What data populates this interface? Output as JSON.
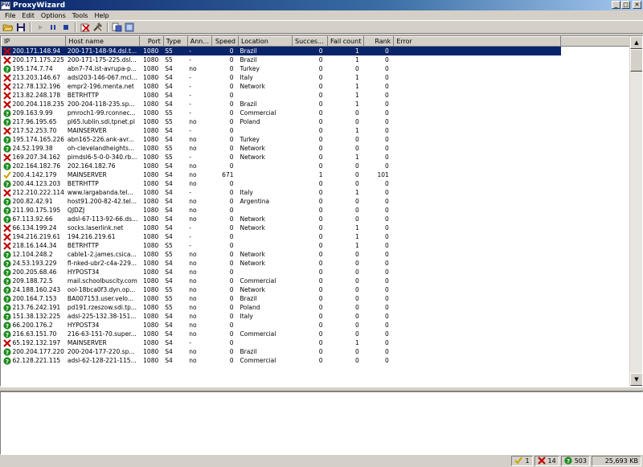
{
  "window": {
    "title": "ProxyWizard",
    "icon_text": "PW"
  },
  "menu": [
    "File",
    "Edit",
    "Options",
    "Tools",
    "Help"
  ],
  "toolbar_icons": [
    "open-folder-icon",
    "save-icon",
    "play-icon",
    "pause-icon",
    "stop-icon",
    "delete-icon",
    "tools-icon",
    "export-icon",
    "settings-icon"
  ],
  "columns": [
    "IP",
    "Host name",
    "Port",
    "Type",
    "Ann...",
    "Speed",
    "Location",
    "Succes...",
    "Fail count",
    "Rank",
    "Error"
  ],
  "colors": {
    "fail": "#c00000",
    "unknown": "#1e8c1e",
    "ok": "#c8a800",
    "selection": "#0a246a"
  },
  "rows": [
    {
      "s": "fail",
      "ip": "200.171.148.94",
      "host": "200-171-148-94.dsl.t...",
      "port": "1080",
      "type": "S5",
      "anon": "-",
      "speed": "0",
      "loc": "Brazil",
      "succ": "0",
      "fail": "1",
      "rank": "0"
    },
    {
      "s": "fail",
      "ip": "200.171.175.225",
      "host": "200-171-175-225.dsl...",
      "port": "1080",
      "type": "S5",
      "anon": "-",
      "speed": "0",
      "loc": "Brazil",
      "succ": "0",
      "fail": "1",
      "rank": "0"
    },
    {
      "s": "unknown",
      "ip": "195.174.7.74",
      "host": "abn7-74.ist-avrupa-p...",
      "port": "1080",
      "type": "S4",
      "anon": "no",
      "speed": "0",
      "loc": "Turkey",
      "succ": "0",
      "fail": "0",
      "rank": "0"
    },
    {
      "s": "fail",
      "ip": "213.203.146.67",
      "host": "adsl203-146-067.mcl...",
      "port": "1080",
      "type": "S4",
      "anon": "-",
      "speed": "0",
      "loc": "Italy",
      "succ": "0",
      "fail": "1",
      "rank": "0"
    },
    {
      "s": "fail",
      "ip": "212.78.132.196",
      "host": "empr2-196.menta.net",
      "port": "1080",
      "type": "S4",
      "anon": "-",
      "speed": "0",
      "loc": "Network",
      "succ": "0",
      "fail": "1",
      "rank": "0"
    },
    {
      "s": "fail",
      "ip": "213.82.248.178",
      "host": "BETRHTTP",
      "port": "1080",
      "type": "S4",
      "anon": "-",
      "speed": "0",
      "loc": "",
      "succ": "0",
      "fail": "1",
      "rank": "0"
    },
    {
      "s": "fail",
      "ip": "200.204.118.235",
      "host": "200-204-118-235.sp...",
      "port": "1080",
      "type": "S4",
      "anon": "-",
      "speed": "0",
      "loc": "Brazil",
      "succ": "0",
      "fail": "1",
      "rank": "0"
    },
    {
      "s": "unknown",
      "ip": "209.163.9.99",
      "host": "pmroch1-99.rconnec...",
      "port": "1080",
      "type": "S5",
      "anon": "-",
      "speed": "0",
      "loc": "Commercial",
      "succ": "0",
      "fail": "0",
      "rank": "0"
    },
    {
      "s": "unknown",
      "ip": "217.96.195.65",
      "host": "pl65.lublin.sdi.tpnet.pl",
      "port": "1080",
      "type": "S5",
      "anon": "no",
      "speed": "0",
      "loc": "Poland",
      "succ": "0",
      "fail": "0",
      "rank": "0"
    },
    {
      "s": "fail",
      "ip": "217.52.253.70",
      "host": "MAINSERVER",
      "port": "1080",
      "type": "S4",
      "anon": "-",
      "speed": "0",
      "loc": "",
      "succ": "0",
      "fail": "1",
      "rank": "0"
    },
    {
      "s": "unknown",
      "ip": "195.174.165.226",
      "host": "abn165-226.ank-avr...",
      "port": "1080",
      "type": "S4",
      "anon": "no",
      "speed": "0",
      "loc": "Turkey",
      "succ": "0",
      "fail": "0",
      "rank": "0"
    },
    {
      "s": "unknown",
      "ip": "24.52.199.38",
      "host": "oh-clevelandheights...",
      "port": "1080",
      "type": "S5",
      "anon": "no",
      "speed": "0",
      "loc": "Network",
      "succ": "0",
      "fail": "0",
      "rank": "0"
    },
    {
      "s": "fail",
      "ip": "169.207.34.162",
      "host": "pimdsl6-5-0-0-340.rb...",
      "port": "1080",
      "type": "S5",
      "anon": "-",
      "speed": "0",
      "loc": "Network",
      "succ": "0",
      "fail": "1",
      "rank": "0"
    },
    {
      "s": "unknown",
      "ip": "202.164.182.76",
      "host": "202.164.182.76",
      "port": "1080",
      "type": "S4",
      "anon": "no",
      "speed": "0",
      "loc": "",
      "succ": "0",
      "fail": "0",
      "rank": "0"
    },
    {
      "s": "ok",
      "ip": "200.4.142.179",
      "host": "MAINSERVER",
      "port": "1080",
      "type": "S4",
      "anon": "no",
      "speed": "671",
      "loc": "",
      "succ": "1",
      "fail": "0",
      "rank": "101"
    },
    {
      "s": "unknown",
      "ip": "200.44.123.203",
      "host": "BETRHTTP",
      "port": "1080",
      "type": "S4",
      "anon": "no",
      "speed": "0",
      "loc": "",
      "succ": "0",
      "fail": "0",
      "rank": "0"
    },
    {
      "s": "fail",
      "ip": "212.210.222.114",
      "host": "www.largabanda.tel...",
      "port": "1080",
      "type": "S4",
      "anon": "-",
      "speed": "0",
      "loc": "Italy",
      "succ": "0",
      "fail": "1",
      "rank": "0"
    },
    {
      "s": "unknown",
      "ip": "200.82.42.91",
      "host": "host91.200-82-42.tel...",
      "port": "1080",
      "type": "S4",
      "anon": "no",
      "speed": "0",
      "loc": "Argentina",
      "succ": "0",
      "fail": "0",
      "rank": "0"
    },
    {
      "s": "unknown",
      "ip": "211.90.175.195",
      "host": "QJDZJ",
      "port": "1080",
      "type": "S4",
      "anon": "no",
      "speed": "0",
      "loc": "",
      "succ": "0",
      "fail": "0",
      "rank": "0"
    },
    {
      "s": "unknown",
      "ip": "67.113.92.66",
      "host": "adsl-67-113-92-66.ds...",
      "port": "1080",
      "type": "S4",
      "anon": "no",
      "speed": "0",
      "loc": "Network",
      "succ": "0",
      "fail": "0",
      "rank": "0"
    },
    {
      "s": "fail",
      "ip": "66.134.199.24",
      "host": "socks.laserlink.net",
      "port": "1080",
      "type": "S4",
      "anon": "-",
      "speed": "0",
      "loc": "Network",
      "succ": "0",
      "fail": "1",
      "rank": "0"
    },
    {
      "s": "fail",
      "ip": "194.216.219.61",
      "host": "194.216.219.61",
      "port": "1080",
      "type": "S4",
      "anon": "-",
      "speed": "0",
      "loc": "",
      "succ": "0",
      "fail": "1",
      "rank": "0"
    },
    {
      "s": "fail",
      "ip": "218.16.144.34",
      "host": "BETRHTTP",
      "port": "1080",
      "type": "S5",
      "anon": "-",
      "speed": "0",
      "loc": "",
      "succ": "0",
      "fail": "1",
      "rank": "0"
    },
    {
      "s": "unknown",
      "ip": "12.104.248.2",
      "host": "cable1-2.james.csica...",
      "port": "1080",
      "type": "S5",
      "anon": "no",
      "speed": "0",
      "loc": "Network",
      "succ": "0",
      "fail": "0",
      "rank": "0"
    },
    {
      "s": "unknown",
      "ip": "24.53.193.229",
      "host": "fl-nked-ubr2-c4a-229...",
      "port": "1080",
      "type": "S4",
      "anon": "no",
      "speed": "0",
      "loc": "Network",
      "succ": "0",
      "fail": "0",
      "rank": "0"
    },
    {
      "s": "unknown",
      "ip": "200.205.68.46",
      "host": "HYPOST34",
      "port": "1080",
      "type": "S4",
      "anon": "no",
      "speed": "0",
      "loc": "",
      "succ": "0",
      "fail": "0",
      "rank": "0"
    },
    {
      "s": "unknown",
      "ip": "209.188.72.5",
      "host": "mail.schoolbuscity.com",
      "port": "1080",
      "type": "S4",
      "anon": "no",
      "speed": "0",
      "loc": "Commercial",
      "succ": "0",
      "fail": "0",
      "rank": "0"
    },
    {
      "s": "unknown",
      "ip": "24.188.160.243",
      "host": "ool-18bca0f3.dyn.op...",
      "port": "1080",
      "type": "S5",
      "anon": "no",
      "speed": "0",
      "loc": "Network",
      "succ": "0",
      "fail": "0",
      "rank": "0"
    },
    {
      "s": "unknown",
      "ip": "200.164.7.153",
      "host": "BA007153.user.velo...",
      "port": "1080",
      "type": "S5",
      "anon": "no",
      "speed": "0",
      "loc": "Brazil",
      "succ": "0",
      "fail": "0",
      "rank": "0"
    },
    {
      "s": "unknown",
      "ip": "213.76.242.191",
      "host": "pd191.rzeszow.sdi.tp...",
      "port": "1080",
      "type": "S5",
      "anon": "no",
      "speed": "0",
      "loc": "Poland",
      "succ": "0",
      "fail": "0",
      "rank": "0"
    },
    {
      "s": "unknown",
      "ip": "151.38.132.225",
      "host": "adsl-225-132.38-151...",
      "port": "1080",
      "type": "S4",
      "anon": "no",
      "speed": "0",
      "loc": "Italy",
      "succ": "0",
      "fail": "0",
      "rank": "0"
    },
    {
      "s": "unknown",
      "ip": "66.200.176.2",
      "host": "HYPOST34",
      "port": "1080",
      "type": "S4",
      "anon": "no",
      "speed": "0",
      "loc": "",
      "succ": "0",
      "fail": "0",
      "rank": "0"
    },
    {
      "s": "unknown",
      "ip": "216.63.151.70",
      "host": "216-63-151-70.super...",
      "port": "1080",
      "type": "S4",
      "anon": "no",
      "speed": "0",
      "loc": "Commercial",
      "succ": "0",
      "fail": "0",
      "rank": "0"
    },
    {
      "s": "fail",
      "ip": "65.192.132.197",
      "host": "MAINSERVER",
      "port": "1080",
      "type": "S4",
      "anon": "-",
      "speed": "0",
      "loc": "",
      "succ": "0",
      "fail": "1",
      "rank": "0"
    },
    {
      "s": "unknown",
      "ip": "200.204.177.220",
      "host": "200-204-177-220.sp...",
      "port": "1080",
      "type": "S4",
      "anon": "no",
      "speed": "0",
      "loc": "Brazil",
      "succ": "0",
      "fail": "0",
      "rank": "0"
    },
    {
      "s": "unknown",
      "ip": "62.128.221.115",
      "host": "adsl-62-128-221-115...",
      "port": "1080",
      "type": "S4",
      "anon": "no",
      "speed": "0",
      "loc": "Commercial",
      "succ": "0",
      "fail": "0",
      "rank": "0"
    }
  ],
  "selected_row": 0,
  "statusbar": {
    "ok_count": "1",
    "fail_count": "14",
    "unknown_count": "503",
    "size": "25,693 KB"
  }
}
